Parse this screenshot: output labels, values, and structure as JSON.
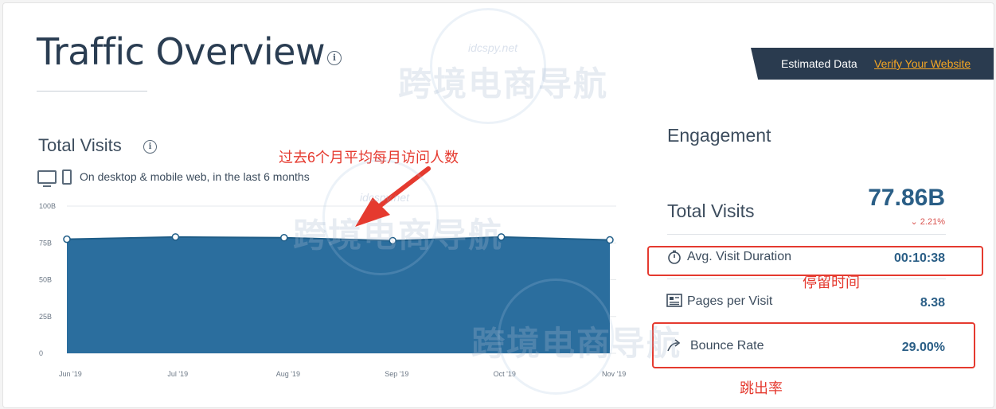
{
  "header": {
    "title": "Traffic Overview",
    "banner_text": "Estimated Data",
    "banner_link": "Verify Your Website"
  },
  "total_visits_section": {
    "title": "Total Visits",
    "device_note": "On desktop & mobile web, in the last 6 months",
    "annotation": "过去6个月平均每月访问人数"
  },
  "chart_data": {
    "type": "area",
    "categories": [
      "Jun '19",
      "Jul '19",
      "Aug '19",
      "Sep '19",
      "Oct '19",
      "Nov '19"
    ],
    "values": [
      77.5,
      79,
      78.5,
      76.5,
      79,
      77
    ],
    "y_ticks": [
      "0",
      "25B",
      "50B",
      "75B",
      "100B"
    ],
    "ylim": [
      0,
      100
    ],
    "grid": true,
    "color": "#2b6e9e"
  },
  "engagement": {
    "title": "Engagement",
    "total_visits_label": "Total Visits",
    "total_visits_value": "77.86B",
    "total_visits_change": "2.21%",
    "metrics": [
      {
        "label": "Avg. Visit Duration",
        "value": "00:10:38",
        "icon": "stopwatch-icon",
        "annotation": "停留时间"
      },
      {
        "label": "Pages per Visit",
        "value": "8.38",
        "icon": "pages-icon"
      },
      {
        "label": "Bounce Rate",
        "value": "29.00%",
        "icon": "bounce-icon",
        "annotation": "跳出率"
      }
    ]
  },
  "watermark": {
    "text": "跨境电商导航",
    "site": "idcspy.net"
  },
  "colors": {
    "accent": "#2a5e86",
    "area": "#2b6e9e",
    "annotation_red": "#e53a2f",
    "banner_bg": "#2a3b4f",
    "banner_link": "#f5a623"
  }
}
